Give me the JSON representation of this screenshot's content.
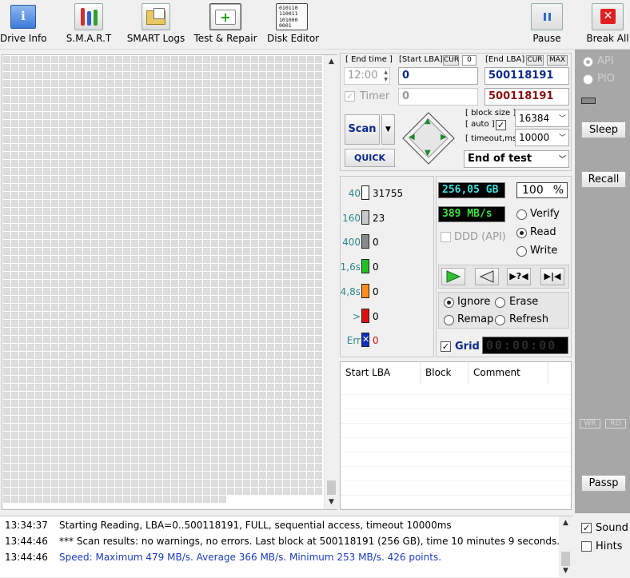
{
  "toolbar": {
    "buttons": [
      {
        "label": "Drive Info",
        "icon": "drive-info-icon"
      },
      {
        "label": "S.M.A.R.T",
        "icon": "smart-icon"
      },
      {
        "label": "SMART Logs",
        "icon": "smart-logs-icon"
      },
      {
        "label": "Test & Repair",
        "icon": "test-repair-icon"
      },
      {
        "label": "Disk Editor",
        "icon": "disk-editor-icon"
      }
    ],
    "pause_label": "Pause",
    "break_label": "Break All",
    "disk_editor_glyph": "010110\n110011\n101000\n0001"
  },
  "controls": {
    "end_time_label": "[ End time ]",
    "start_lba_label": "[Start LBA]",
    "cur_tag": "CUR",
    "cur_value": "0",
    "end_lba_label": "[End LBA]",
    "cur_tag2": "CUR",
    "max_tag": "MAX",
    "end_time_value": "12:00",
    "start_lba_value": "0",
    "end_lba_value": "500118191",
    "timer_label": "Timer",
    "timer_value": "0",
    "end_lba_value2": "500118191",
    "scan_label": "Scan",
    "quick_label": "QUICK",
    "block_size_label": "[ block size ]",
    "auto_label": "[ auto ]",
    "block_size_value": "16384",
    "timeout_label": "[ timeout,ms ]",
    "timeout_value": "10000",
    "end_action_value": "End of test"
  },
  "legend": [
    {
      "label": "40",
      "color": "#ffffff",
      "count": "31755"
    },
    {
      "label": "160",
      "color": "#c8c8c8",
      "count": "23"
    },
    {
      "label": "400",
      "color": "#8a8a8a",
      "count": "0"
    },
    {
      "label": "1,6s",
      "color": "#22c022",
      "count": "0"
    },
    {
      "label": "4,8s",
      "color": "#ff8c1a",
      "count": "0"
    },
    {
      "label": ">",
      "color": "#e01010",
      "count": "0"
    },
    {
      "label": "Err",
      "color": "#1030c0",
      "count": "0"
    }
  ],
  "readouts": {
    "size": "256,05 GB",
    "percent": "100",
    "percent_unit": "%",
    "speed": "389 MB/s"
  },
  "mode": {
    "verify_label": "Verify",
    "read_label": "Read",
    "write_label": "Write",
    "ddd_label": "DDD (API)",
    "selected": "read"
  },
  "action": {
    "ignore_label": "Ignore",
    "erase_label": "Erase",
    "remap_label": "Remap",
    "refresh_label": "Refresh",
    "selected": "ignore"
  },
  "grid": {
    "label": "Grid",
    "checked": true,
    "timer": "00:00:00"
  },
  "table": {
    "columns": [
      "Start LBA",
      "Block",
      "Comment"
    ],
    "rows": []
  },
  "sidebar": {
    "api_label": "API",
    "pio_label": "PIO",
    "sleep_label": "Sleep",
    "recall_label": "Recall",
    "wr_label": "WR",
    "rd_label": "RD",
    "passp_label": "Passp"
  },
  "log": [
    {
      "time": "13:34:37",
      "text": "Starting Reading, LBA=0..500118191, FULL, sequential access, timeout 10000ms",
      "color": "#000000"
    },
    {
      "time": "13:44:46",
      "text": "*** Scan results: no warnings, no errors. Last block at 500118191 (256 GB), time 10 minutes 9 seconds.",
      "color": "#000000"
    },
    {
      "time": "13:44:46",
      "text": "Speed: Maximum 479 MB/s. Average 366 MB/s. Minimum 253 MB/s. 426 points.",
      "color": "#1a3cc0"
    }
  ],
  "options": {
    "sound_label": "Sound",
    "sound_checked": true,
    "hints_label": "Hints",
    "hints_checked": false
  },
  "colors": {
    "accent_blue": "#0a2a8a",
    "end_lba_red": "#8a1010",
    "lcd_cyan": "#40e0e0",
    "lcd_green": "#40e040",
    "sidebar_gray": "#a7a7a7",
    "cell_gray": "#dcdcdc"
  }
}
